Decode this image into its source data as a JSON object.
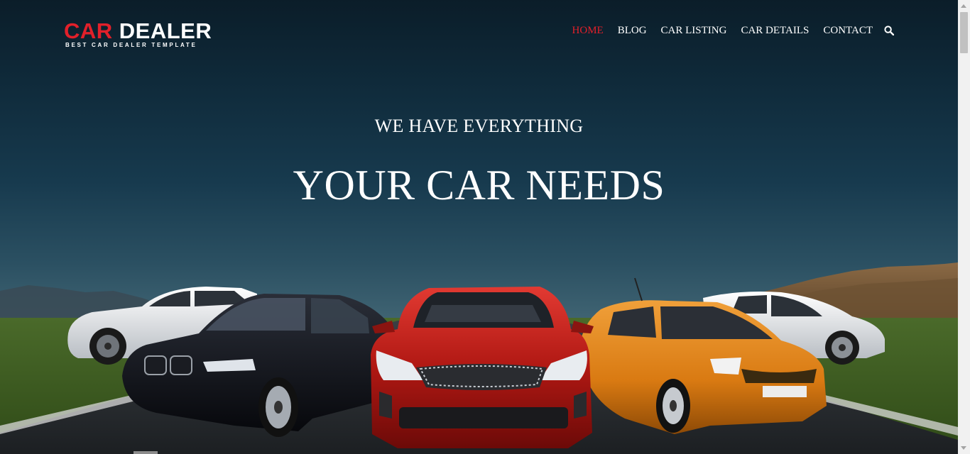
{
  "logo": {
    "word_car": "CAR",
    "word_dealer": " DEALER",
    "tagline": "BEST CAR DEALER TEMPLATE"
  },
  "nav": {
    "items": [
      {
        "label": "HOME",
        "active": true
      },
      {
        "label": "BLOG",
        "active": false
      },
      {
        "label": "CAR LISTING",
        "active": false
      },
      {
        "label": "CAR DETAILS",
        "active": false
      },
      {
        "label": "CONTACT",
        "active": false
      }
    ],
    "search_icon": "search-icon"
  },
  "hero": {
    "subheading": "WE HAVE EVERYTHING",
    "heading": "YOUR CAR NEEDS",
    "cars": [
      "white-suv",
      "black-suv",
      "red-sedan",
      "orange-hatchback",
      "white-hatchback"
    ]
  },
  "colors": {
    "accent": "#e2202a",
    "nav_text": "#ffffff",
    "sky_top": "#0b1d29"
  }
}
